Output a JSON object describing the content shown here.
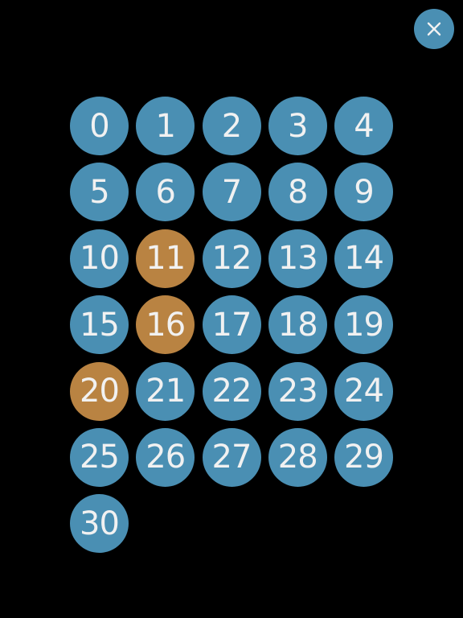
{
  "colors": {
    "background": "#000000",
    "number_default": "#4a8fb3",
    "number_selected": "#b98342",
    "text": "#f1f1f1",
    "close_button": "#4a8fb3",
    "close_icon": "#f1f1f1"
  },
  "close_button": {
    "icon": "close-icon"
  },
  "numbers": [
    {
      "label": "0",
      "selected": false
    },
    {
      "label": "1",
      "selected": false
    },
    {
      "label": "2",
      "selected": false
    },
    {
      "label": "3",
      "selected": false
    },
    {
      "label": "4",
      "selected": false
    },
    {
      "label": "5",
      "selected": false
    },
    {
      "label": "6",
      "selected": false
    },
    {
      "label": "7",
      "selected": false
    },
    {
      "label": "8",
      "selected": false
    },
    {
      "label": "9",
      "selected": false
    },
    {
      "label": "10",
      "selected": false
    },
    {
      "label": "11",
      "selected": true
    },
    {
      "label": "12",
      "selected": false
    },
    {
      "label": "13",
      "selected": false
    },
    {
      "label": "14",
      "selected": false
    },
    {
      "label": "15",
      "selected": false
    },
    {
      "label": "16",
      "selected": true
    },
    {
      "label": "17",
      "selected": false
    },
    {
      "label": "18",
      "selected": false
    },
    {
      "label": "19",
      "selected": false
    },
    {
      "label": "20",
      "selected": true
    },
    {
      "label": "21",
      "selected": false
    },
    {
      "label": "22",
      "selected": false
    },
    {
      "label": "23",
      "selected": false
    },
    {
      "label": "24",
      "selected": false
    },
    {
      "label": "25",
      "selected": false
    },
    {
      "label": "26",
      "selected": false
    },
    {
      "label": "27",
      "selected": false
    },
    {
      "label": "28",
      "selected": false
    },
    {
      "label": "29",
      "selected": false
    },
    {
      "label": "30",
      "selected": false
    }
  ]
}
